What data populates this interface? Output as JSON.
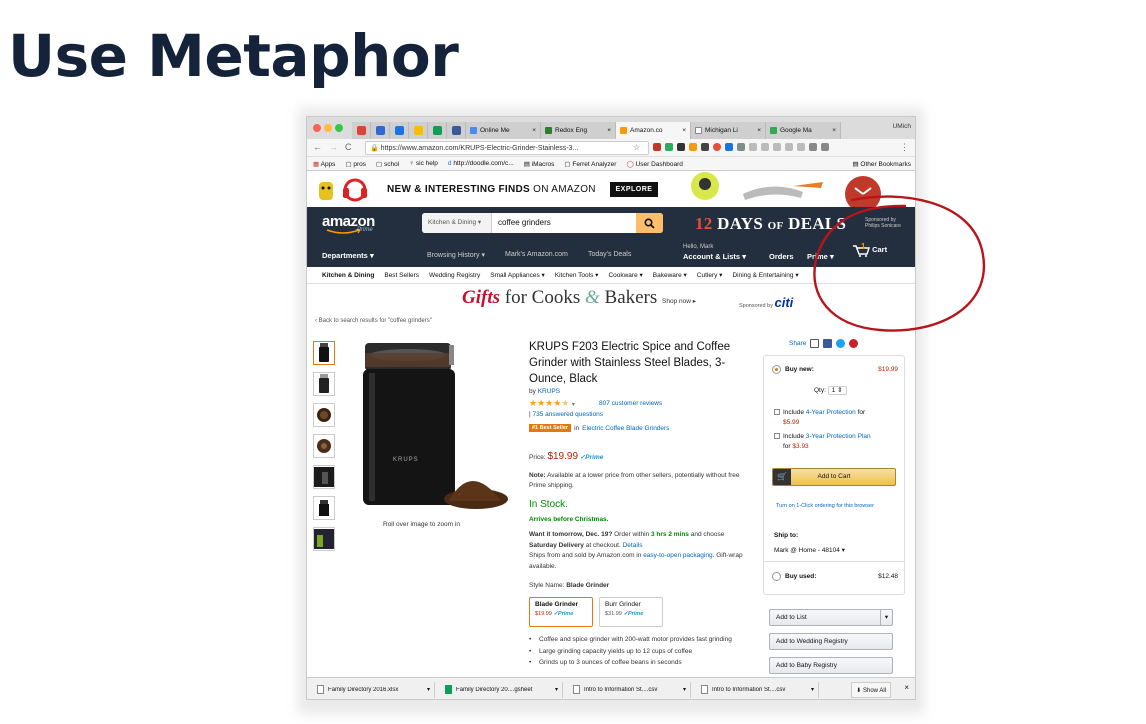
{
  "slide": {
    "title": "Use Metaphor"
  },
  "browser": {
    "user": "UMich",
    "tabs": [
      {
        "label": "Online Me",
        "color": "#4a8af4"
      },
      {
        "label": "Redox Eng",
        "color": "#2e7d32"
      },
      {
        "label": "Amazon.co",
        "color": "#ff9900",
        "active": true
      },
      {
        "label": "Michigan Li",
        "color": "#555555"
      },
      {
        "label": "Google Ma",
        "color": "#34a853"
      }
    ],
    "url": "https://www.amazon.com/KRUPS-Electric-Grinder-Stainless-3...",
    "bookmarks": [
      "Apps",
      "pros",
      "schol",
      "sic help",
      "http://doodle.com/c...",
      "iMacros",
      "Ferret Analyzer",
      "User Dashboard"
    ],
    "other_bookmarks": "Other Bookmarks"
  },
  "promo": {
    "text1": "NEW & INTERESTING FINDS",
    "text2": "ON AMAZON",
    "explore": "EXPLORE"
  },
  "header": {
    "logo": "amazon",
    "logo_sub": "Prime",
    "search_category": "Kitchen & Dining",
    "search_term": "coffee grinders",
    "deals_num": "12",
    "deals_word": "DAYS",
    "deals_of": "OF",
    "deals_end": "DEALS",
    "sponsored": "Sponsored by",
    "sponsor_name": "Philips Sonicare",
    "departments": "Departments",
    "browsing_history": "Browsing History",
    "marks_amazon": "Mark's Amazon.com",
    "todays_deals": "Today's Deals",
    "hello": "Hello, Mark",
    "account": "Account & Lists",
    "orders": "Orders",
    "prime": "Prime",
    "cart": "Cart",
    "cart_count": "1"
  },
  "subnav": [
    "Kitchen & Dining",
    "Best Sellers",
    "Wedding Registry",
    "Small Appliances",
    "Kitchen Tools",
    "Cookware",
    "Bakeware",
    "Cutlery",
    "Dining & Entertaining"
  ],
  "gifts_banner": {
    "gifts": "Gifts",
    "for_cooks": "for Cooks",
    "amp": "&",
    "bakers": "Bakers",
    "shop_now": "Shop now",
    "sponsored_by": "Sponsored by",
    "sponsor": "citi"
  },
  "back_link": "‹ Back to search results for \"coffee grinders\"",
  "product": {
    "title": "KRUPS F203 Electric Spice and Coffee Grinder with Stainless Steel Blades, 3-Ounce, Black",
    "brand_prefix": "by",
    "brand": "KRUPS",
    "rating": 4.5,
    "reviews": "807 customer reviews",
    "answered": "735 answered questions",
    "best_seller_badge": "#1 Best Seller",
    "best_seller_in": "in",
    "best_seller_category": "Electric Coffee Blade Grinders",
    "price_label": "Price:",
    "price": "$19.99",
    "prime": "Prime",
    "note_label": "Note:",
    "note": "Available at a lower price from other sellers, potentially without free Prime shipping.",
    "in_stock": "In Stock.",
    "arrives": "Arrives before Christmas.",
    "want_tomorrow": "Want it tomorrow, Dec. 19?",
    "order_within": "Order within",
    "time_left": "3 hrs 2 mins",
    "and_choose": "and choose",
    "saturday": "Saturday Delivery",
    "at_checkout": "at checkout.",
    "details": "Details",
    "ships_from": "Ships from and sold by Amazon.com in",
    "easy_open": "easy-to-open packaging",
    "gift_wrap": ". Gift-wrap available.",
    "style_label": "Style Name:",
    "style_value": "Blade Grinder",
    "options": [
      {
        "name": "Blade Grinder",
        "price": "$19.99",
        "selected": true
      },
      {
        "name": "Burr Grinder",
        "price": "$31.99",
        "selected": false
      }
    ],
    "bullets": [
      "Coffee and spice grinder with 200-watt motor provides fast grinding",
      "Large grinding capacity yields up to 12 cups of coffee",
      "Grinds up to 3 ounces of coffee beans in seconds"
    ],
    "image_text": "KRUPS",
    "rollover": "Roll over image to zoom in"
  },
  "buybox": {
    "share": "Share",
    "buy_new": "Buy new:",
    "buy_new_price": "$19.99",
    "qty_label": "Qty:",
    "qty": "1",
    "include": "Include",
    "protection4": "4-Year Protection",
    "for": "for",
    "protection4_price": "$5.99",
    "protection3": "3-Year Protection Plan",
    "protection3_price": "$3.93",
    "add_to_cart": "Add to Cart",
    "one_click": "Turn on 1-Click ordering for this browser",
    "ship_to_label": "Ship to:",
    "ship_to": "Mark @ Home - 48104",
    "buy_used": "Buy used:",
    "buy_used_price": "$12.48",
    "add_to_list": "Add to List",
    "wedding": "Add to Wedding Registry",
    "baby": "Add to Baby Registry"
  },
  "downloads": {
    "items": [
      "Family Directory 2016.xlsx",
      "Family Directory 20....gsheet",
      "Intro to Information St....csv",
      "Intro to Information St....csv"
    ],
    "show_all": "Show All"
  }
}
